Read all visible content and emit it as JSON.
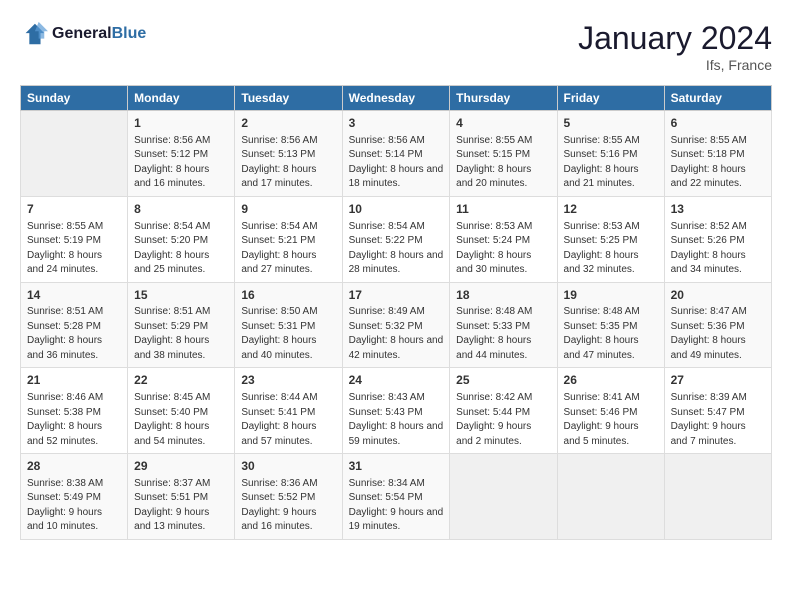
{
  "header": {
    "logo_line1": "General",
    "logo_line2": "Blue",
    "title": "January 2024",
    "location": "Ifs, France"
  },
  "columns": [
    "Sunday",
    "Monday",
    "Tuesday",
    "Wednesday",
    "Thursday",
    "Friday",
    "Saturday"
  ],
  "weeks": [
    [
      {
        "day": "",
        "sunrise": "",
        "sunset": "",
        "daylight": ""
      },
      {
        "day": "1",
        "sunrise": "Sunrise: 8:56 AM",
        "sunset": "Sunset: 5:12 PM",
        "daylight": "Daylight: 8 hours and 16 minutes."
      },
      {
        "day": "2",
        "sunrise": "Sunrise: 8:56 AM",
        "sunset": "Sunset: 5:13 PM",
        "daylight": "Daylight: 8 hours and 17 minutes."
      },
      {
        "day": "3",
        "sunrise": "Sunrise: 8:56 AM",
        "sunset": "Sunset: 5:14 PM",
        "daylight": "Daylight: 8 hours and 18 minutes."
      },
      {
        "day": "4",
        "sunrise": "Sunrise: 8:55 AM",
        "sunset": "Sunset: 5:15 PM",
        "daylight": "Daylight: 8 hours and 20 minutes."
      },
      {
        "day": "5",
        "sunrise": "Sunrise: 8:55 AM",
        "sunset": "Sunset: 5:16 PM",
        "daylight": "Daylight: 8 hours and 21 minutes."
      },
      {
        "day": "6",
        "sunrise": "Sunrise: 8:55 AM",
        "sunset": "Sunset: 5:18 PM",
        "daylight": "Daylight: 8 hours and 22 minutes."
      }
    ],
    [
      {
        "day": "7",
        "sunrise": "Sunrise: 8:55 AM",
        "sunset": "Sunset: 5:19 PM",
        "daylight": "Daylight: 8 hours and 24 minutes."
      },
      {
        "day": "8",
        "sunrise": "Sunrise: 8:54 AM",
        "sunset": "Sunset: 5:20 PM",
        "daylight": "Daylight: 8 hours and 25 minutes."
      },
      {
        "day": "9",
        "sunrise": "Sunrise: 8:54 AM",
        "sunset": "Sunset: 5:21 PM",
        "daylight": "Daylight: 8 hours and 27 minutes."
      },
      {
        "day": "10",
        "sunrise": "Sunrise: 8:54 AM",
        "sunset": "Sunset: 5:22 PM",
        "daylight": "Daylight: 8 hours and 28 minutes."
      },
      {
        "day": "11",
        "sunrise": "Sunrise: 8:53 AM",
        "sunset": "Sunset: 5:24 PM",
        "daylight": "Daylight: 8 hours and 30 minutes."
      },
      {
        "day": "12",
        "sunrise": "Sunrise: 8:53 AM",
        "sunset": "Sunset: 5:25 PM",
        "daylight": "Daylight: 8 hours and 32 minutes."
      },
      {
        "day": "13",
        "sunrise": "Sunrise: 8:52 AM",
        "sunset": "Sunset: 5:26 PM",
        "daylight": "Daylight: 8 hours and 34 minutes."
      }
    ],
    [
      {
        "day": "14",
        "sunrise": "Sunrise: 8:51 AM",
        "sunset": "Sunset: 5:28 PM",
        "daylight": "Daylight: 8 hours and 36 minutes."
      },
      {
        "day": "15",
        "sunrise": "Sunrise: 8:51 AM",
        "sunset": "Sunset: 5:29 PM",
        "daylight": "Daylight: 8 hours and 38 minutes."
      },
      {
        "day": "16",
        "sunrise": "Sunrise: 8:50 AM",
        "sunset": "Sunset: 5:31 PM",
        "daylight": "Daylight: 8 hours and 40 minutes."
      },
      {
        "day": "17",
        "sunrise": "Sunrise: 8:49 AM",
        "sunset": "Sunset: 5:32 PM",
        "daylight": "Daylight: 8 hours and 42 minutes."
      },
      {
        "day": "18",
        "sunrise": "Sunrise: 8:48 AM",
        "sunset": "Sunset: 5:33 PM",
        "daylight": "Daylight: 8 hours and 44 minutes."
      },
      {
        "day": "19",
        "sunrise": "Sunrise: 8:48 AM",
        "sunset": "Sunset: 5:35 PM",
        "daylight": "Daylight: 8 hours and 47 minutes."
      },
      {
        "day": "20",
        "sunrise": "Sunrise: 8:47 AM",
        "sunset": "Sunset: 5:36 PM",
        "daylight": "Daylight: 8 hours and 49 minutes."
      }
    ],
    [
      {
        "day": "21",
        "sunrise": "Sunrise: 8:46 AM",
        "sunset": "Sunset: 5:38 PM",
        "daylight": "Daylight: 8 hours and 52 minutes."
      },
      {
        "day": "22",
        "sunrise": "Sunrise: 8:45 AM",
        "sunset": "Sunset: 5:40 PM",
        "daylight": "Daylight: 8 hours and 54 minutes."
      },
      {
        "day": "23",
        "sunrise": "Sunrise: 8:44 AM",
        "sunset": "Sunset: 5:41 PM",
        "daylight": "Daylight: 8 hours and 57 minutes."
      },
      {
        "day": "24",
        "sunrise": "Sunrise: 8:43 AM",
        "sunset": "Sunset: 5:43 PM",
        "daylight": "Daylight: 8 hours and 59 minutes."
      },
      {
        "day": "25",
        "sunrise": "Sunrise: 8:42 AM",
        "sunset": "Sunset: 5:44 PM",
        "daylight": "Daylight: 9 hours and 2 minutes."
      },
      {
        "day": "26",
        "sunrise": "Sunrise: 8:41 AM",
        "sunset": "Sunset: 5:46 PM",
        "daylight": "Daylight: 9 hours and 5 minutes."
      },
      {
        "day": "27",
        "sunrise": "Sunrise: 8:39 AM",
        "sunset": "Sunset: 5:47 PM",
        "daylight": "Daylight: 9 hours and 7 minutes."
      }
    ],
    [
      {
        "day": "28",
        "sunrise": "Sunrise: 8:38 AM",
        "sunset": "Sunset: 5:49 PM",
        "daylight": "Daylight: 9 hours and 10 minutes."
      },
      {
        "day": "29",
        "sunrise": "Sunrise: 8:37 AM",
        "sunset": "Sunset: 5:51 PM",
        "daylight": "Daylight: 9 hours and 13 minutes."
      },
      {
        "day": "30",
        "sunrise": "Sunrise: 8:36 AM",
        "sunset": "Sunset: 5:52 PM",
        "daylight": "Daylight: 9 hours and 16 minutes."
      },
      {
        "day": "31",
        "sunrise": "Sunrise: 8:34 AM",
        "sunset": "Sunset: 5:54 PM",
        "daylight": "Daylight: 9 hours and 19 minutes."
      },
      {
        "day": "",
        "sunrise": "",
        "sunset": "",
        "daylight": ""
      },
      {
        "day": "",
        "sunrise": "",
        "sunset": "",
        "daylight": ""
      },
      {
        "day": "",
        "sunrise": "",
        "sunset": "",
        "daylight": ""
      }
    ]
  ]
}
